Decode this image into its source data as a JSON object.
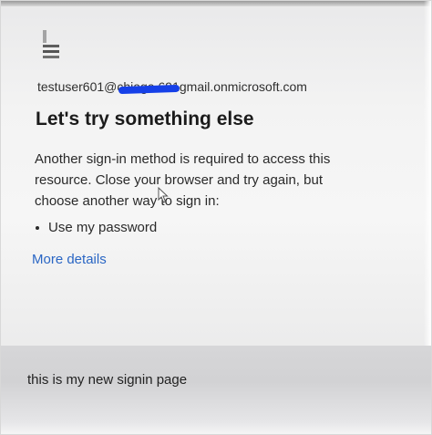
{
  "signin": {
    "logo_icon": "microsoft-logo-icon",
    "email_prefix": "testuser601@",
    "email_redacted": "chiaga    691",
    "email_suffix": "gmail.onmicrosoft.com",
    "heading": "Let's try something else",
    "body_line_1": "Another sign-in method is required to access this",
    "body_line_2": "resource. Close your browser and try again, but",
    "body_line_3": "choose another way to sign in:",
    "options": [
      "Use my password"
    ],
    "more_details": "More details",
    "link_color": "#2a66c4",
    "redaction_color": "#1640e8"
  },
  "caption": "this is my new signin page"
}
